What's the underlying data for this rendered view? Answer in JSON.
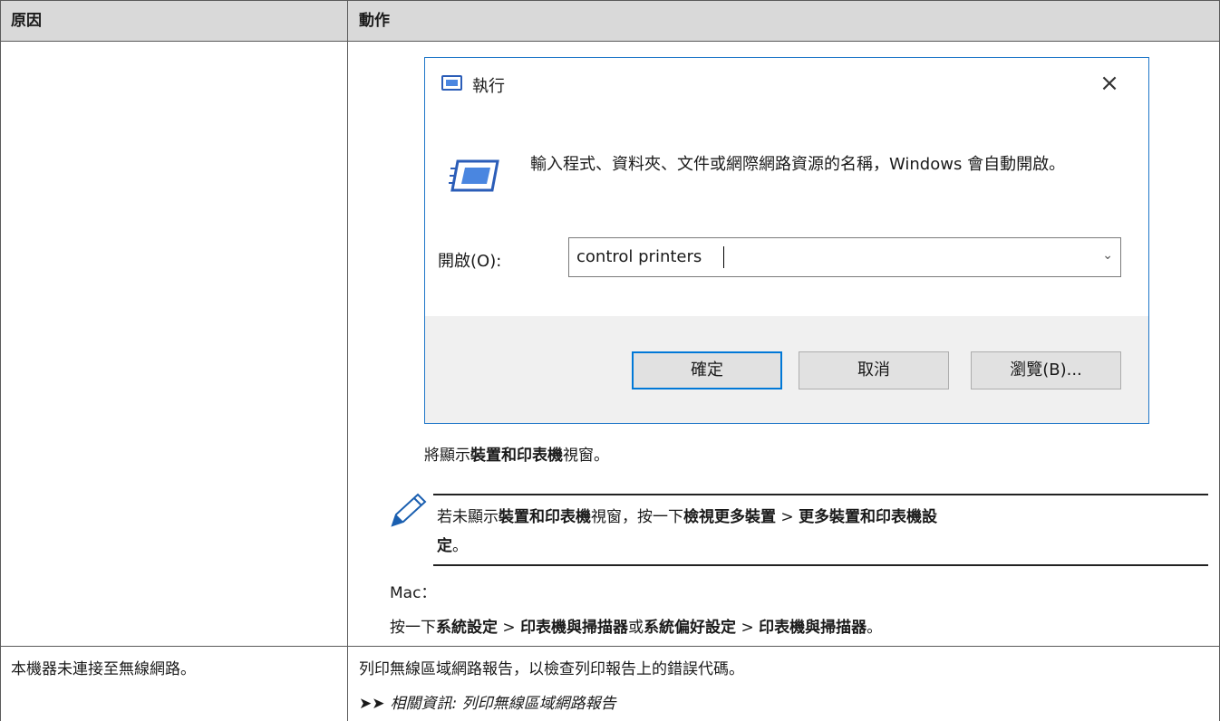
{
  "table": {
    "headers": [
      "原因",
      "動作"
    ],
    "row1_action": {
      "dialog": {
        "title": "執行",
        "close_symbol": "×",
        "message": "輸入程式、資料夾、文件或網際網路資源的名稱，Windows 會自動開啟。",
        "open_label": "開啟(O):",
        "input_value": "control printers",
        "buttons": {
          "ok": "確定",
          "cancel": "取消",
          "browse": "瀏覽(B)..."
        }
      },
      "after_text": {
        "pre": "將顯示",
        "bold": "裝置和印表機",
        "post": "視窗。"
      },
      "note": {
        "p1": "若未顯示",
        "b1": "裝置和印表機",
        "p2": "視窗，按一下",
        "b2": "檢視更多裝置",
        "p3": " > ",
        "b3": "更多裝置和印表機設",
        "b4": "定",
        "p4": "。"
      },
      "mac_label": "Mac：",
      "mac_text": {
        "p1": "按一下",
        "b1": "系統設定",
        "p2": " > ",
        "b2": "印表機與掃描器",
        "p3": "或",
        "b3": "系統偏好設定",
        "p4": " > ",
        "b4": "印表機與掃描器",
        "p5": "。"
      }
    },
    "row2": {
      "cause": "本機器未連接至無線網路。",
      "action": "列印無線區域網路報告，以檢查列印報告上的錯誤代碼。",
      "link_prefix": "相關資訊",
      "link_sep": ": ",
      "link_text": "列印無線區域網路報告"
    }
  }
}
